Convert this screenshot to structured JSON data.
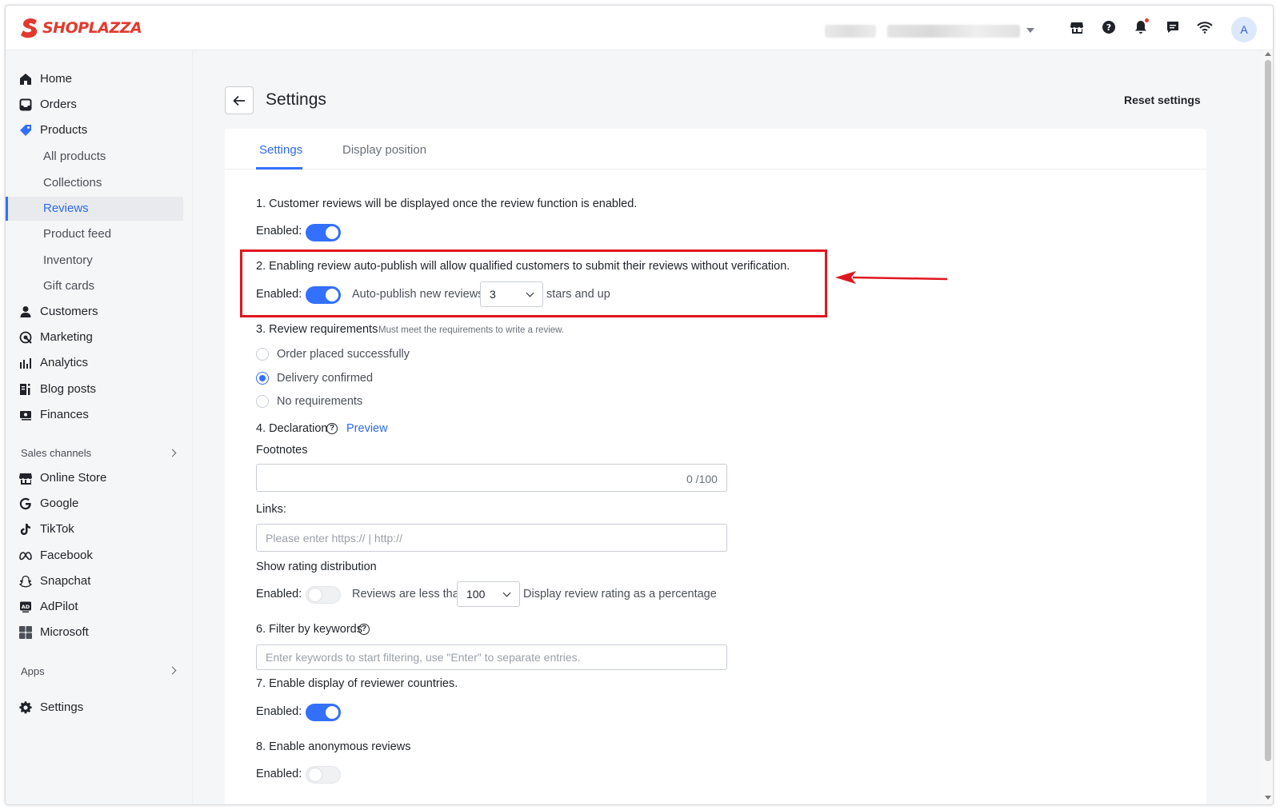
{
  "topbar": {
    "logo_text": "SHOPLAZZA",
    "brand_color": "#e23a2e",
    "icons": [
      "store-icon",
      "help-icon",
      "bell-icon",
      "message-icon",
      "wifi-icon"
    ],
    "avatar_letter": "A"
  },
  "sidebar": {
    "items": [
      {
        "label": "Home",
        "icon": "home-icon"
      },
      {
        "label": "Orders",
        "icon": "orders-icon"
      },
      {
        "label": "Products",
        "icon": "tag-icon"
      }
    ],
    "product_subitems": [
      "All products",
      "Collections",
      "Reviews",
      "Product feed",
      "Inventory",
      "Gift cards"
    ],
    "active_subitem": "Reviews",
    "more_items": [
      {
        "label": "Customers",
        "icon": "person-icon"
      },
      {
        "label": "Marketing",
        "icon": "marketing-icon"
      },
      {
        "label": "Analytics",
        "icon": "analytics-icon"
      },
      {
        "label": "Blog posts",
        "icon": "blog-icon"
      },
      {
        "label": "Finances",
        "icon": "finances-icon"
      }
    ],
    "sales_channels_label": "Sales channels",
    "channels": [
      {
        "label": "Online Store",
        "icon": "store-icon"
      },
      {
        "label": "Google",
        "icon": "google-icon"
      },
      {
        "label": "TikTok",
        "icon": "tiktok-icon"
      },
      {
        "label": "Facebook",
        "icon": "meta-icon"
      },
      {
        "label": "Snapchat",
        "icon": "snapchat-icon"
      },
      {
        "label": "AdPilot",
        "icon": "adpilot-icon"
      },
      {
        "label": "Microsoft",
        "icon": "microsoft-icon"
      }
    ],
    "apps_label": "Apps",
    "settings_label": "Settings"
  },
  "main": {
    "title": "Settings",
    "reset_label": "Reset settings",
    "tabs": [
      {
        "label": "Settings",
        "active": true
      },
      {
        "label": "Display position",
        "active": false
      }
    ],
    "section1": {
      "text": "1. Customer reviews will be displayed once the review function is enabled.",
      "enabled_label": "Enabled:",
      "enabled": true
    },
    "section2": {
      "text": "2. Enabling review auto-publish will allow qualified customers to submit their reviews without verification.",
      "enabled_label": "Enabled:",
      "enabled": true,
      "auto_publish_label": "Auto-publish new reviews",
      "stars_value": "3",
      "stars_suffix": "stars and up"
    },
    "section3": {
      "text": "3. Review requirements",
      "hint": "Must meet the requirements to write a review.",
      "options": [
        {
          "label": "Order placed successfully",
          "checked": false
        },
        {
          "label": "Delivery confirmed",
          "checked": true
        },
        {
          "label": "No requirements",
          "checked": false
        }
      ]
    },
    "section4": {
      "text": "4. Declaration",
      "preview_label": "Preview",
      "footnotes_label": "Footnotes",
      "footnotes_value": "",
      "footnotes_counter": "0 /100",
      "links_label": "Links:",
      "links_placeholder": "Please enter https:// | http://"
    },
    "section5": {
      "text": "Show rating distribution",
      "enabled_label": "Enabled:",
      "enabled": false,
      "reviews_less_label": "Reviews are less than",
      "reviews_value": "100",
      "display_suffix": "Display review rating as a percentage"
    },
    "section6": {
      "text": "6. Filter by keywords",
      "placeholder": "Enter keywords to start filtering, use \"Enter\" to separate entries."
    },
    "section7": {
      "text": "7. Enable display of reviewer countries.",
      "enabled_label": "Enabled:",
      "enabled": true
    },
    "section8": {
      "text": "8. Enable anonymous reviews",
      "enabled_label": "Enabled:",
      "enabled": false
    }
  },
  "colors": {
    "accent": "#3370ff",
    "highlight_red": "#e0161f"
  }
}
